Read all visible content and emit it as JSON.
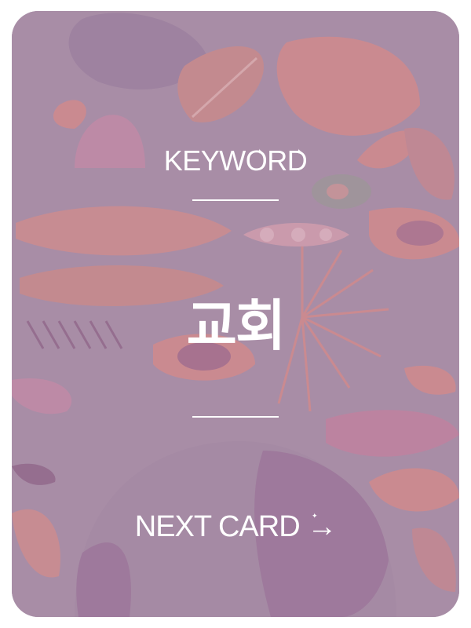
{
  "card": {
    "keyword_title": "KEYWORD",
    "keyword": "교회",
    "next_button_label": "NEXT CARD →"
  },
  "colors": {
    "card_background": "#a98ea6",
    "pattern_coral": "#d98a87",
    "pattern_pink": "#c78aa8",
    "pattern_plum": "#8f6385",
    "text": "#ffffff"
  },
  "icons": {
    "sparkle": "four-point-star"
  }
}
